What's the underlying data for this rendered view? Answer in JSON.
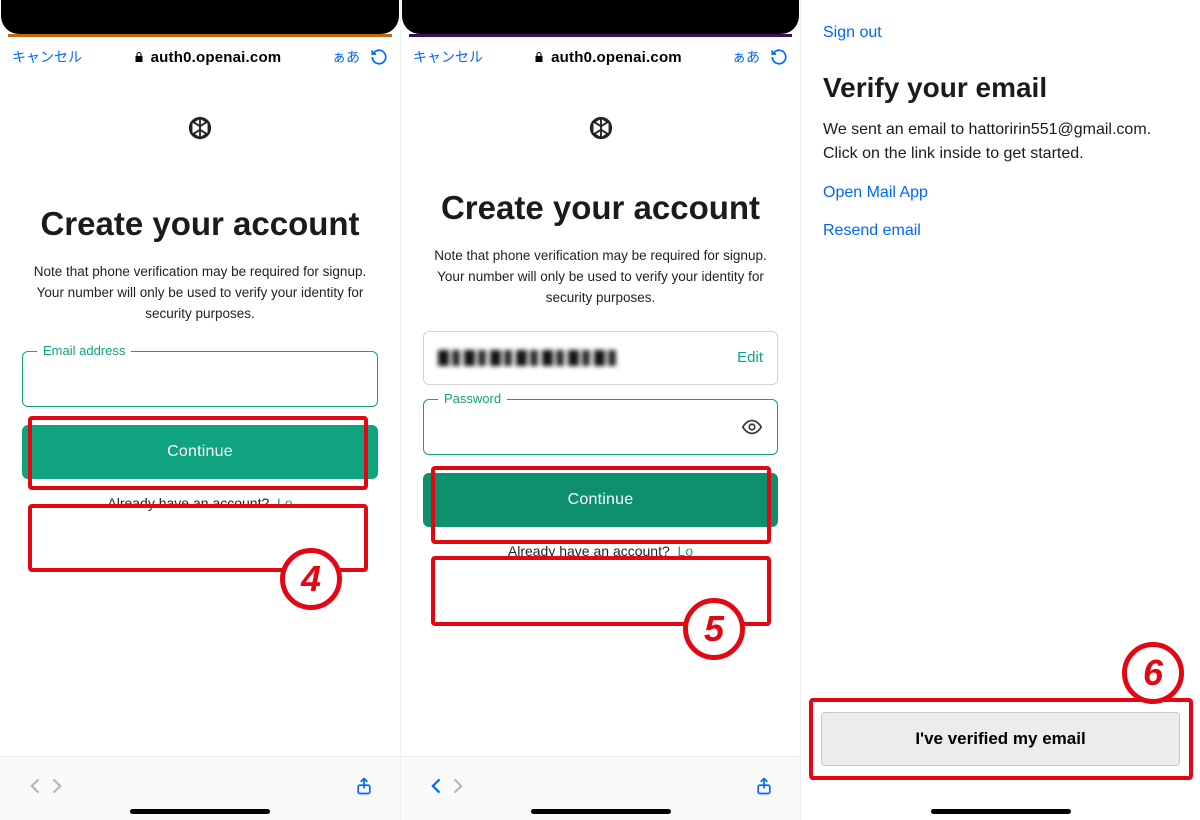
{
  "safari": {
    "cancel": "キャンセル",
    "domain": "auth0.openai.com",
    "aa": "ぁあ"
  },
  "pane1": {
    "headline": "Create your account",
    "sub": "Note that phone verification may be required for signup. Your number will only be used to verify your identity for security purposes.",
    "email_label": "Email address",
    "continue": "Continue",
    "already": "Already have an account?",
    "login": "Lo",
    "step": "4"
  },
  "pane2": {
    "headline": "Create your account",
    "sub": "Note that phone verification may be required for signup. Your number will only be used to verify your identity for security purposes.",
    "edit": "Edit",
    "password_label": "Password",
    "continue": "Continue",
    "already": "Already have an account?",
    "login": "Lo",
    "step": "5"
  },
  "pane3": {
    "signout": "Sign out",
    "title": "Verify your email",
    "body": "We sent an email to hattoririn551@gmail.com. Click on the link inside to get started.",
    "open_mail": "Open Mail App",
    "resend": "Resend email",
    "verified": "I've verified my email",
    "step": "6"
  }
}
